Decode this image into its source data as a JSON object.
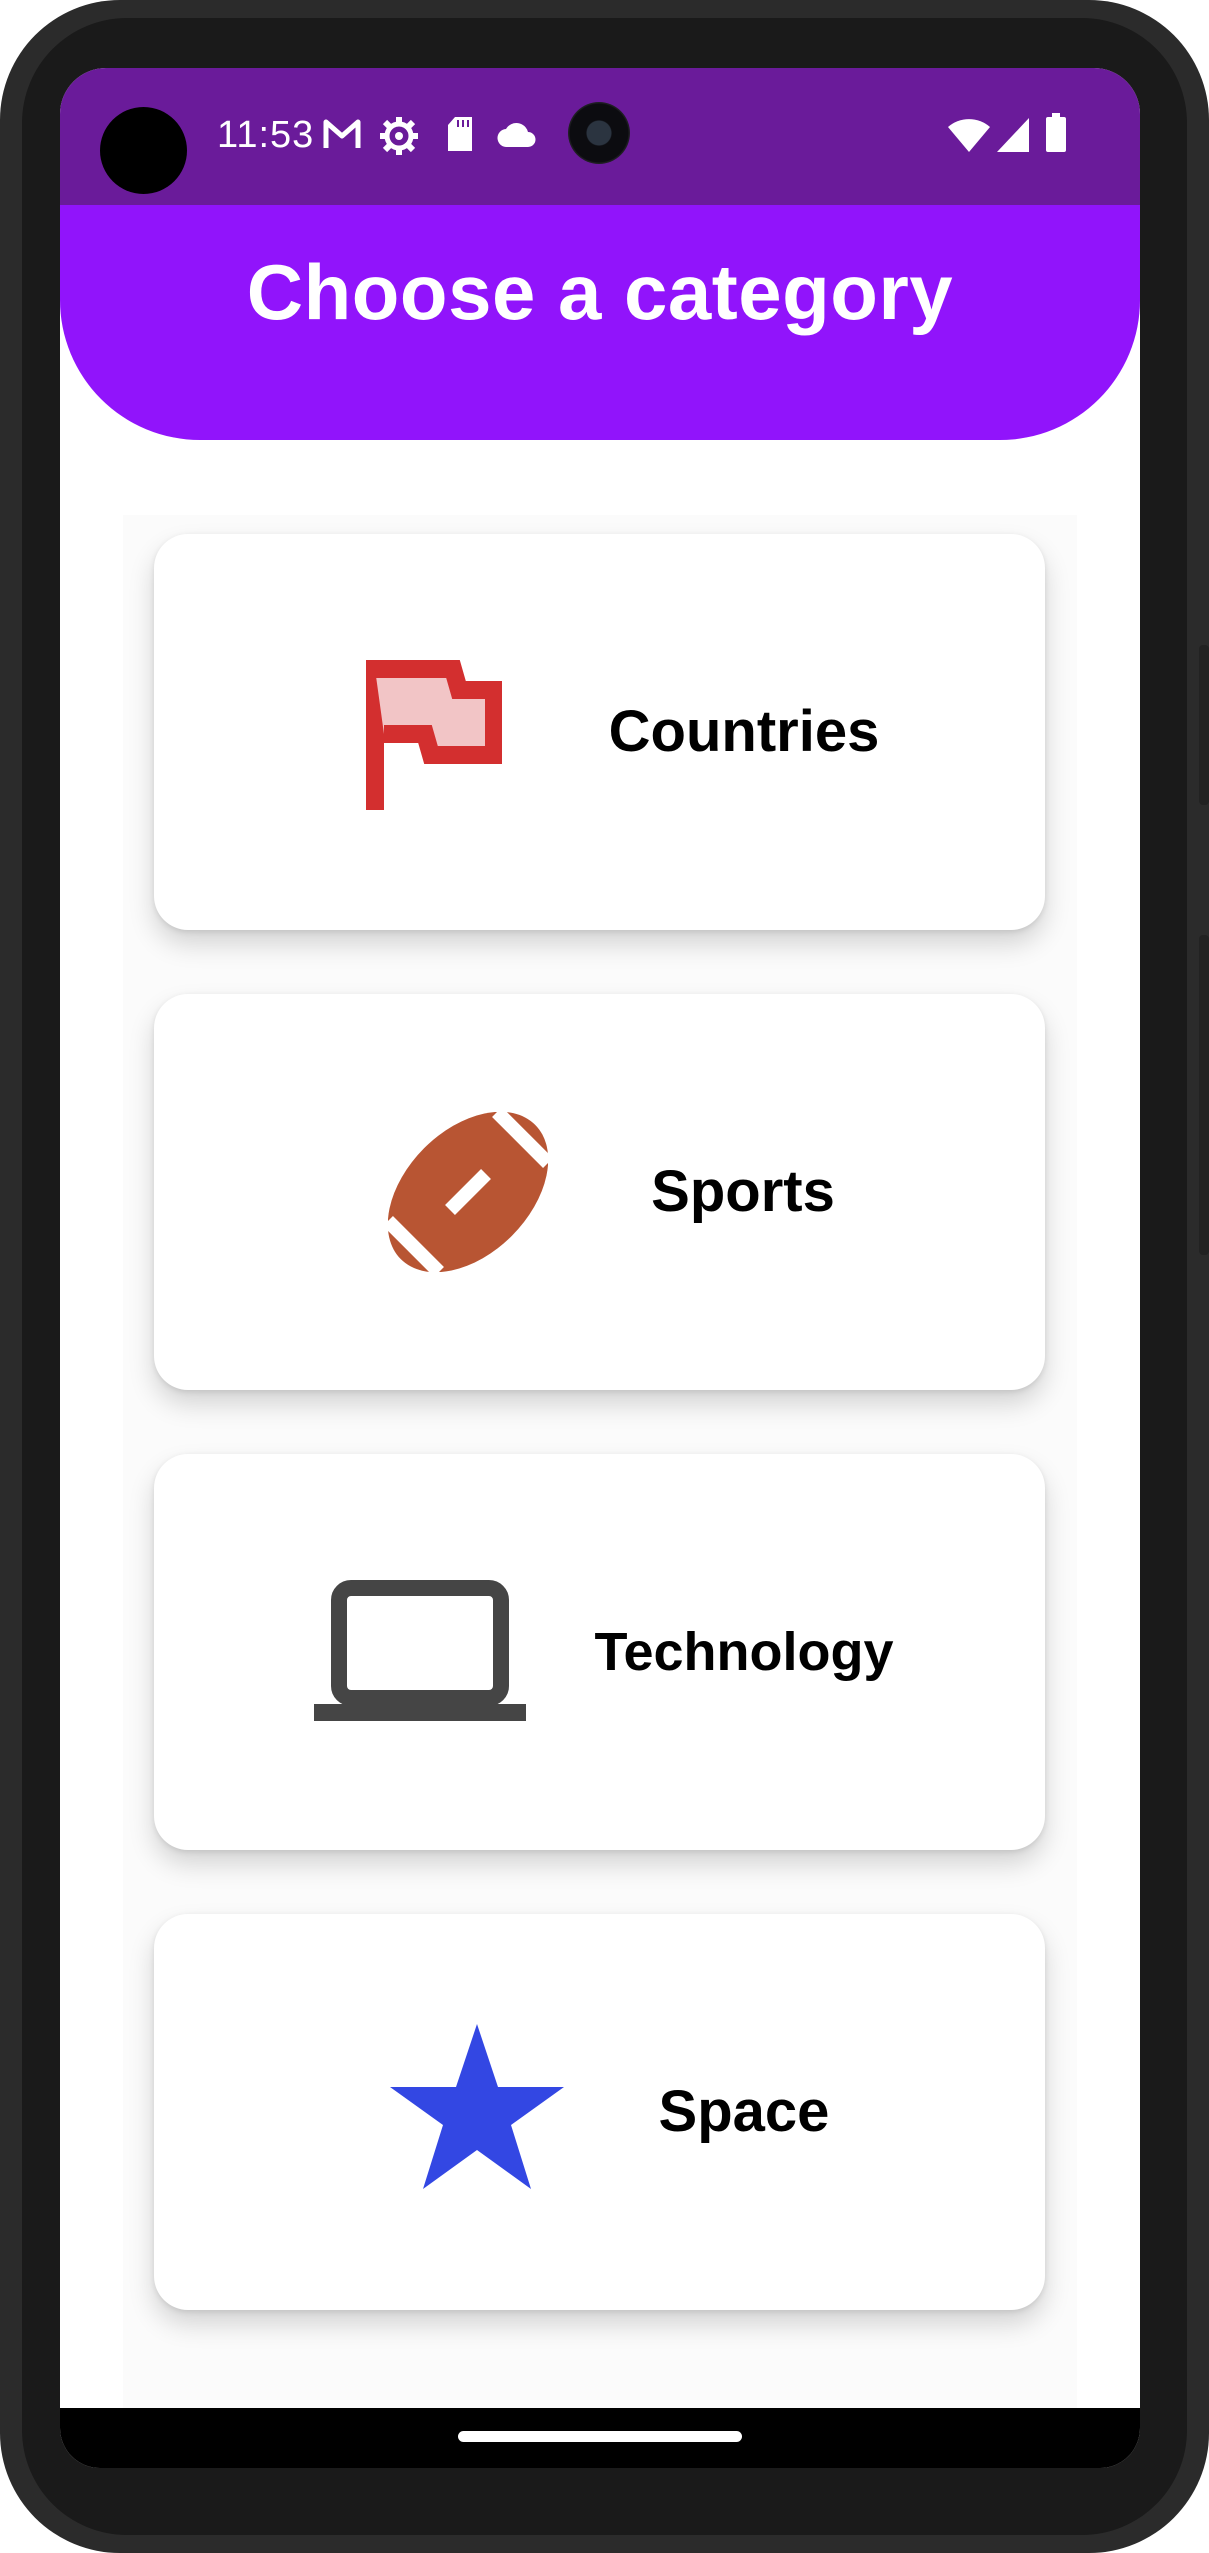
{
  "status_bar": {
    "time": "11:53",
    "left_icons": [
      "gmail-icon",
      "settings-gear-icon",
      "sd-card-icon",
      "cloud-icon"
    ],
    "right_icons": [
      "wifi-icon",
      "cellular-signal-icon",
      "battery-icon"
    ],
    "background_color": "#6a1b9a"
  },
  "header": {
    "title": "Choose a category",
    "background_color": "#9114fb"
  },
  "categories": [
    {
      "label": "Countries",
      "icon": "flag-icon",
      "icon_color": "#d32f2f"
    },
    {
      "label": "Sports",
      "icon": "football-icon",
      "icon_color": "#b85533"
    },
    {
      "label": "Technology",
      "icon": "laptop-icon",
      "icon_color": "#454545"
    },
    {
      "label": "Space",
      "icon": "star-icon",
      "icon_color": "#3347e3"
    }
  ]
}
